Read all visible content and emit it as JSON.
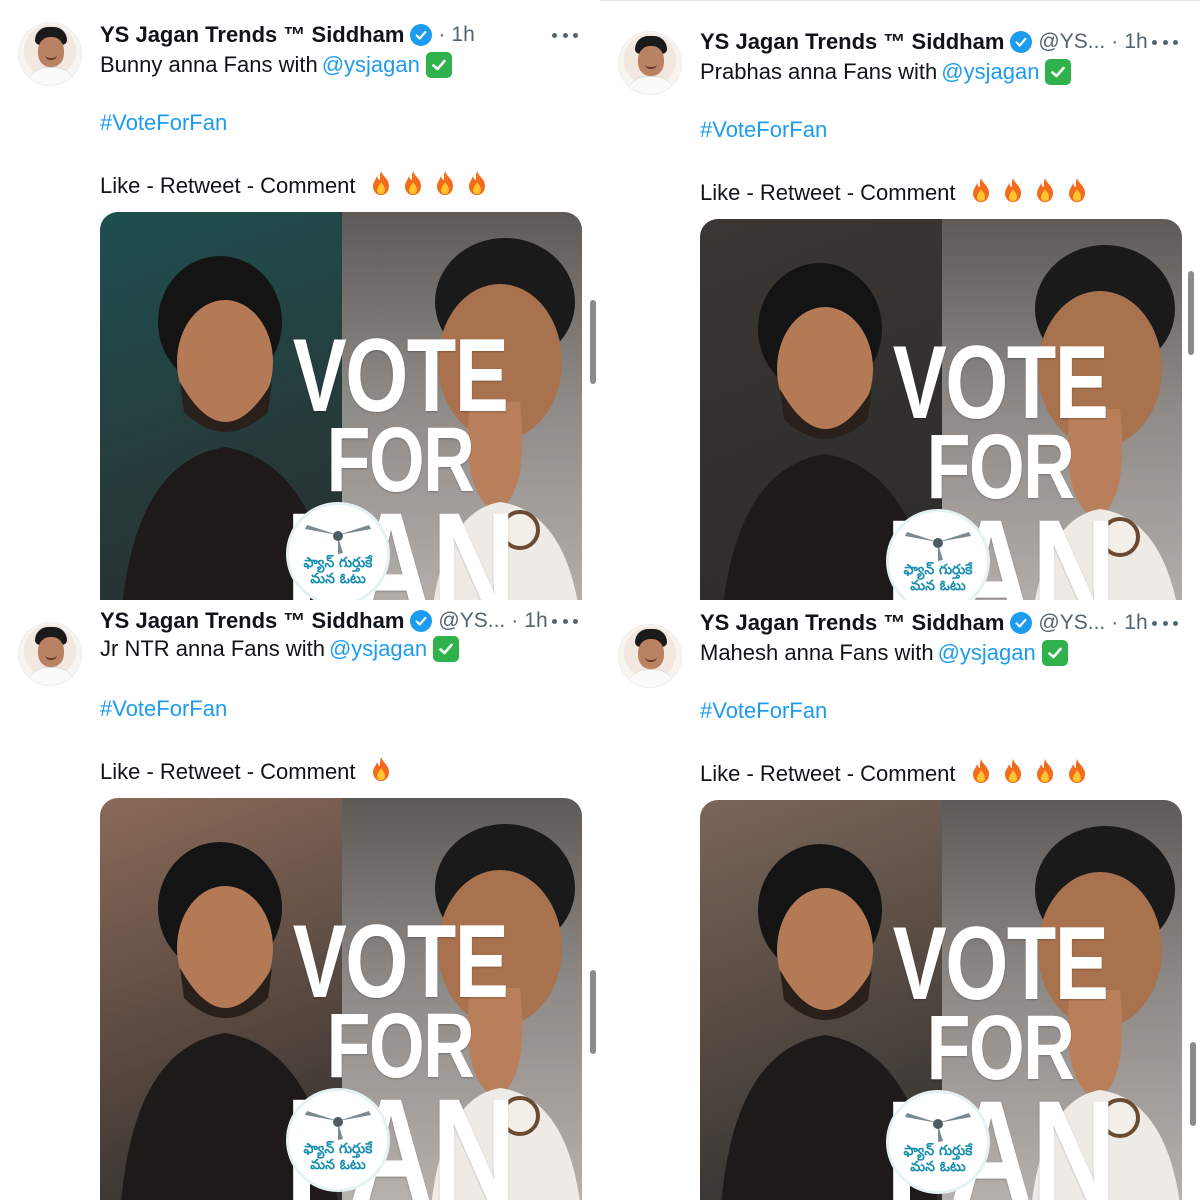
{
  "panels": [
    {
      "author": {
        "name": "YS Jagan Trends ™ Siddham",
        "handle": "",
        "time": "1h",
        "dot": "·"
      },
      "text": {
        "prefix": "Bunny anna Fans with",
        "mention": "@ysjagan",
        "hashtag": "#VoteForFan",
        "cta": "Like - Retweet - Comment"
      },
      "fire_count": 4,
      "image": {
        "line1": "VOTE",
        "line2": "FOR",
        "line3": "FAN",
        "badge_line1": "ఫ్యాన్ గుర్తుకే",
        "badge_line2": "మన ఓటు"
      },
      "left_bg": "#1f4f4f"
    },
    {
      "author": {
        "name": "YS Jagan Trends ™ Siddham",
        "handle": "@YS...",
        "time": "1h",
        "dot": "·"
      },
      "text": {
        "prefix": "Prabhas anna Fans with",
        "mention": "@ysjagan",
        "hashtag": "#VoteForFan",
        "cta": "Like - Retweet - Comment"
      },
      "fire_count": 4,
      "image": {
        "line1": "VOTE",
        "line2": "FOR",
        "line3": "FAN",
        "badge_line1": "ఫ్యాన్ గుర్తుకే",
        "badge_line2": "మన ఓటు"
      },
      "left_bg": "#3a3633"
    },
    {
      "author": {
        "name": "YS Jagan Trends ™ Siddham",
        "handle": "@YS...",
        "time": "1h",
        "dot": "·"
      },
      "text": {
        "prefix": "Jr NTR anna Fans with",
        "mention": "@ysjagan",
        "hashtag": "#VoteForFan",
        "cta": "Like - Retweet - Comment"
      },
      "fire_count": 1,
      "image": {
        "line1": "VOTE",
        "line2": "FOR",
        "line3": "FAN",
        "badge_line1": "ఫ్యాన్ గుర్తుకే",
        "badge_line2": "మన ఓటు"
      },
      "left_bg": "#8a6a58"
    },
    {
      "author": {
        "name": "YS Jagan Trends ™ Siddham",
        "handle": "@YS...",
        "time": "1h",
        "dot": "·"
      },
      "text": {
        "prefix": "Mahesh anna Fans with",
        "mention": "@ysjagan",
        "hashtag": "#VoteForFan",
        "cta": "Like - Retweet - Comment"
      },
      "fire_count": 4,
      "image": {
        "line1": "VOTE",
        "line2": "FOR",
        "line3": "FAN",
        "badge_line1": "ఫ్యాన్ గుర్తుకే",
        "badge_line2": "మన ఓటు"
      },
      "left_bg": "#7a6658"
    }
  ],
  "icons": {
    "verified": "verified-badge-icon",
    "more": "more-options-icon",
    "check": "check-mark-emoji-icon",
    "fire": "fire-emoji-icon",
    "fan": "ceiling-fan-icon"
  },
  "colors": {
    "link": "#1d9bf0",
    "verified": "#1d9bf0",
    "check": "#2fb24c",
    "muted": "#536471",
    "badge_text": "#1a8fb0"
  }
}
